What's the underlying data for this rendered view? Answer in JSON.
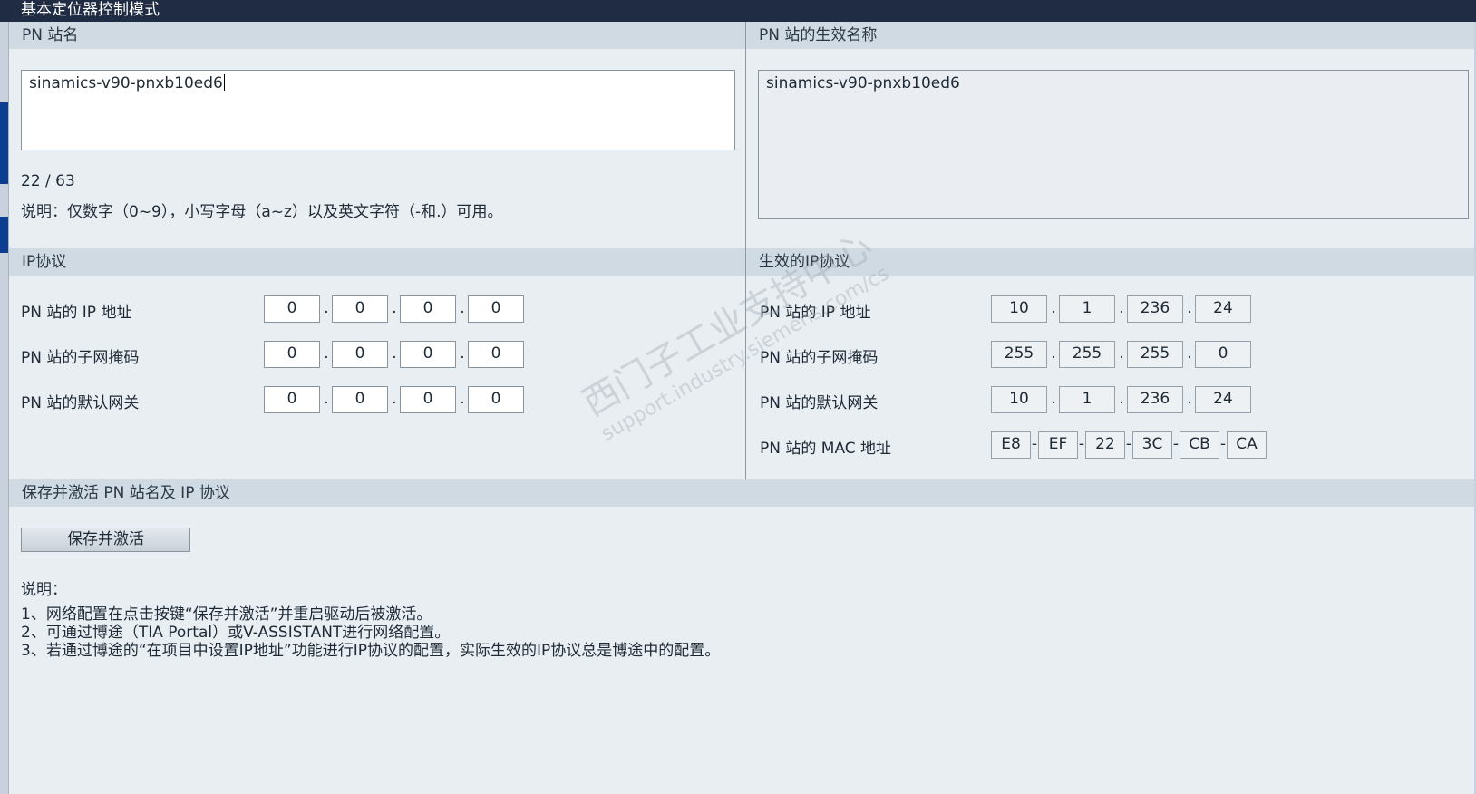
{
  "window": {
    "title": "基本定位器控制模式"
  },
  "left": {
    "station_name_header": "PN 站名",
    "station_name_value": "sinamics-v90-pnxb10ed6",
    "char_count": "22 / 63",
    "char_hint": "说明：仅数字（0~9），小写字母（a~z）以及英文字符（-和.）可用。",
    "ip_header": "IP协议",
    "rows": [
      {
        "label": "PN 站的 IP 地址",
        "octets": [
          "0",
          "0",
          "0",
          "0"
        ]
      },
      {
        "label": "PN 站的子网掩码",
        "octets": [
          "0",
          "0",
          "0",
          "0"
        ]
      },
      {
        "label": "PN 站的默认网关",
        "octets": [
          "0",
          "0",
          "0",
          "0"
        ]
      }
    ],
    "separator": "."
  },
  "right": {
    "effective_name_header": "PN 站的生效名称",
    "effective_name_value": "sinamics-v90-pnxb10ed6",
    "ip_header": "生效的IP协议",
    "rows": [
      {
        "label": "PN 站的 IP 地址",
        "octets": [
          "10",
          "1",
          "236",
          "24"
        ]
      },
      {
        "label": "PN 站的子网掩码",
        "octets": [
          "255",
          "255",
          "255",
          "0"
        ]
      },
      {
        "label": "PN 站的默认网关",
        "octets": [
          "10",
          "1",
          "236",
          "24"
        ]
      }
    ],
    "mac_label": "PN 站的 MAC 地址",
    "mac": [
      "E8",
      "EF",
      "22",
      "3C",
      "CB",
      "CA"
    ],
    "ip_separator": ".",
    "mac_separator": "-"
  },
  "save": {
    "header": "保存并激活 PN 站名及 IP 协议",
    "button_label": "保存并激活",
    "notes_title": "说明：",
    "notes": [
      "1、网络配置在点击按键“保存并激活”并重启驱动后被激活。",
      "2、可通过博途（TIA Portal）或V-ASSISTANT进行网络配置。",
      "3、若通过博途的“在项目中设置IP地址”功能进行IP协议的配置，实际生效的IP协议总是博途中的配置。"
    ]
  },
  "watermark": {
    "line1": "西门子工业支持中心",
    "line2": "support.industry.siemens.com/cs"
  }
}
